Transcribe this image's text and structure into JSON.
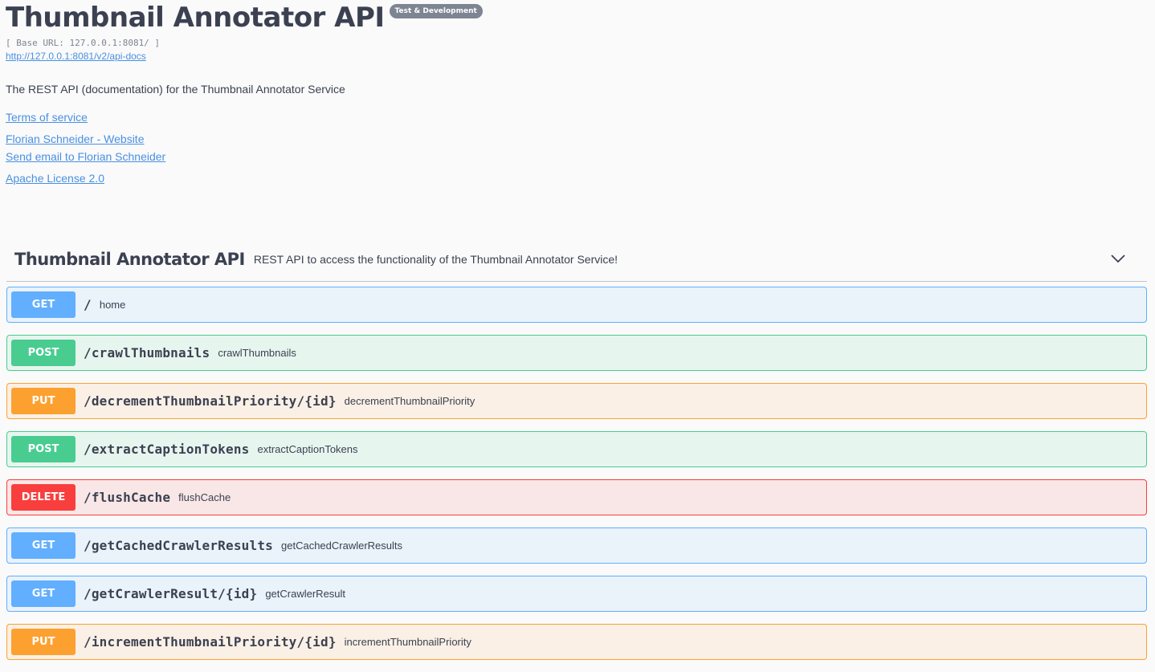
{
  "info": {
    "title": "Thumbnail Annotator API",
    "version_badge": "Test & Development",
    "base_url": "[ Base URL: 127.0.0.1:8081/ ]",
    "spec_link": "http://127.0.0.1:8081/v2/api-docs",
    "description": "The REST API (documentation) for the Thumbnail Annotator Service",
    "terms": "Terms of service",
    "contact_website": "Florian Schneider - Website",
    "contact_email": "Send email to Florian Schneider",
    "license": "Apache License 2.0"
  },
  "tag": {
    "name": "Thumbnail Annotator API",
    "description": "REST API to access the functionality of the Thumbnail Annotator Service!",
    "expand_icon": "chevron-down-icon"
  },
  "operations": [
    {
      "method": "GET",
      "path": "/",
      "summary": "home"
    },
    {
      "method": "POST",
      "path": "/crawlThumbnails",
      "summary": "crawlThumbnails"
    },
    {
      "method": "PUT",
      "path": "/decrementThumbnailPriority/{id}",
      "summary": "decrementThumbnailPriority"
    },
    {
      "method": "POST",
      "path": "/extractCaptionTokens",
      "summary": "extractCaptionTokens"
    },
    {
      "method": "DELETE",
      "path": "/flushCache",
      "summary": "flushCache"
    },
    {
      "method": "GET",
      "path": "/getCachedCrawlerResults",
      "summary": "getCachedCrawlerResults"
    },
    {
      "method": "GET",
      "path": "/getCrawlerResult/{id}",
      "summary": "getCrawlerResult"
    },
    {
      "method": "PUT",
      "path": "/incrementThumbnailPriority/{id}",
      "summary": "incrementThumbnailPriority"
    }
  ],
  "colors": {
    "get": "#61affe",
    "post": "#49cc90",
    "put": "#fca130",
    "delete": "#f93e3e",
    "link": "#4990e2",
    "text": "#3b4151"
  }
}
